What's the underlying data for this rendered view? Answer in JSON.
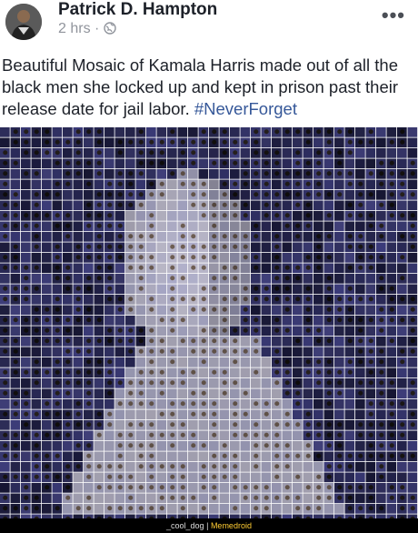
{
  "post": {
    "author": "Patrick D. Hampton",
    "time": "2 hrs",
    "separator": "·",
    "privacy_icon": "globe-icon",
    "more_icon": "more-options-icon",
    "text": "Beautiful Mosaic of Kamala Harris made out of all the black men she locked up and kept in prison past their release date for jail labor.",
    "hashtag": "#NeverForget"
  },
  "watermark": {
    "user": "_cool_dog",
    "divider": "|",
    "brand": "Memedroid"
  },
  "colors": {
    "hashtag": "#365899",
    "mosaic_dark": "#1c2240",
    "mosaic_light": "#c8cad4"
  }
}
